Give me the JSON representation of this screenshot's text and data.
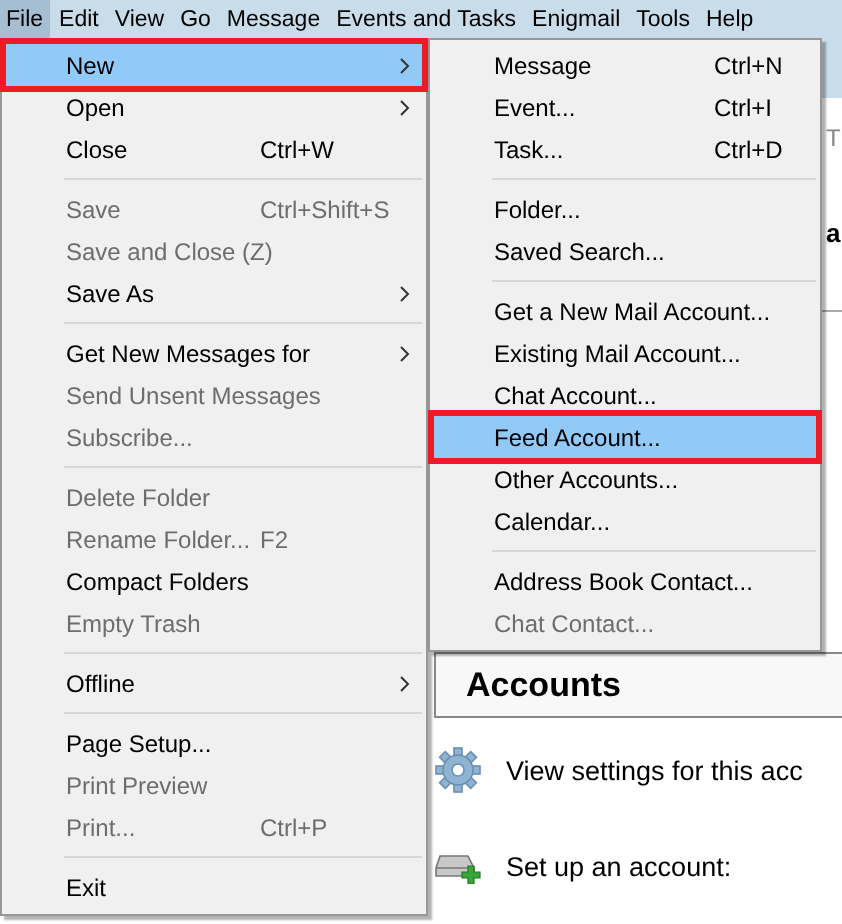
{
  "menu_bar": [
    {
      "label": "File",
      "selected": true
    },
    {
      "label": "Edit",
      "selected": false
    },
    {
      "label": "View",
      "selected": false
    },
    {
      "label": "Go",
      "selected": false
    },
    {
      "label": "Message",
      "selected": false
    },
    {
      "label": "Events and Tasks",
      "selected": false
    },
    {
      "label": "Enigmail",
      "selected": false
    },
    {
      "label": "Tools",
      "selected": false
    },
    {
      "label": "Help",
      "selected": false
    }
  ],
  "background": {
    "tab_label": "T",
    "heading": "a",
    "accounts": {
      "title": "Accounts",
      "rows": [
        {
          "kind": "settings",
          "label": "View settings for this acc"
        },
        {
          "kind": "setup",
          "label": "Set up an account:"
        }
      ]
    }
  },
  "file_menu": [
    {
      "kind": "item",
      "label": "New",
      "submenu": true,
      "disabled": false,
      "selected": true,
      "outlined": true
    },
    {
      "kind": "item",
      "label": "Open",
      "submenu": true,
      "disabled": false,
      "selected": false,
      "outlined": false
    },
    {
      "kind": "item",
      "label": "Close",
      "shortcut": "Ctrl+W",
      "disabled": false,
      "selected": false,
      "outlined": false
    },
    {
      "kind": "separator"
    },
    {
      "kind": "item",
      "label": "Save",
      "shortcut": "Ctrl+Shift+S",
      "disabled": true,
      "selected": false,
      "outlined": false
    },
    {
      "kind": "item",
      "label": "Save and Close (Z)",
      "disabled": true,
      "selected": false,
      "outlined": false
    },
    {
      "kind": "item",
      "label": "Save As",
      "submenu": true,
      "disabled": false,
      "selected": false,
      "outlined": false
    },
    {
      "kind": "separator"
    },
    {
      "kind": "item",
      "label": "Get New Messages for",
      "submenu": true,
      "disabled": false,
      "selected": false,
      "outlined": false
    },
    {
      "kind": "item",
      "label": "Send Unsent Messages",
      "disabled": true,
      "selected": false,
      "outlined": false
    },
    {
      "kind": "item",
      "label": "Subscribe...",
      "disabled": true,
      "selected": false,
      "outlined": false
    },
    {
      "kind": "separator"
    },
    {
      "kind": "item",
      "label": "Delete Folder",
      "disabled": true,
      "selected": false,
      "outlined": false
    },
    {
      "kind": "item",
      "label": "Rename Folder...",
      "shortcut": "F2",
      "disabled": true,
      "selected": false,
      "outlined": false
    },
    {
      "kind": "item",
      "label": "Compact Folders",
      "disabled": false,
      "selected": false,
      "outlined": false
    },
    {
      "kind": "item",
      "label": "Empty Trash",
      "disabled": true,
      "selected": false,
      "outlined": false
    },
    {
      "kind": "separator"
    },
    {
      "kind": "item",
      "label": "Offline",
      "submenu": true,
      "disabled": false,
      "selected": false,
      "outlined": false
    },
    {
      "kind": "separator"
    },
    {
      "kind": "item",
      "label": "Page Setup...",
      "disabled": false,
      "selected": false,
      "outlined": false
    },
    {
      "kind": "item",
      "label": "Print Preview",
      "disabled": true,
      "selected": false,
      "outlined": false
    },
    {
      "kind": "item",
      "label": "Print...",
      "shortcut": "Ctrl+P",
      "disabled": true,
      "selected": false,
      "outlined": false
    },
    {
      "kind": "separator"
    },
    {
      "kind": "item",
      "label": "Exit",
      "disabled": false,
      "selected": false,
      "outlined": false
    }
  ],
  "new_submenu": [
    {
      "kind": "item",
      "label": "Message",
      "shortcut": "Ctrl+N",
      "disabled": false,
      "selected": false,
      "outlined": false
    },
    {
      "kind": "item",
      "label": "Event...",
      "shortcut": "Ctrl+I",
      "disabled": false,
      "selected": false,
      "outlined": false
    },
    {
      "kind": "item",
      "label": "Task...",
      "shortcut": "Ctrl+D",
      "disabled": false,
      "selected": false,
      "outlined": false
    },
    {
      "kind": "separator"
    },
    {
      "kind": "item",
      "label": "Folder...",
      "disabled": false,
      "selected": false,
      "outlined": false
    },
    {
      "kind": "item",
      "label": "Saved Search...",
      "disabled": false,
      "selected": false,
      "outlined": false
    },
    {
      "kind": "separator"
    },
    {
      "kind": "item",
      "label": "Get a New Mail Account...",
      "disabled": false,
      "selected": false,
      "outlined": false
    },
    {
      "kind": "item",
      "label": "Existing Mail Account...",
      "disabled": false,
      "selected": false,
      "outlined": false
    },
    {
      "kind": "item",
      "label": "Chat Account...",
      "disabled": false,
      "selected": false,
      "outlined": false
    },
    {
      "kind": "item",
      "label": "Feed Account...",
      "disabled": false,
      "selected": true,
      "outlined": true
    },
    {
      "kind": "item",
      "label": "Other Accounts...",
      "disabled": false,
      "selected": false,
      "outlined": false
    },
    {
      "kind": "item",
      "label": "Calendar...",
      "disabled": false,
      "selected": false,
      "outlined": false
    },
    {
      "kind": "separator"
    },
    {
      "kind": "item",
      "label": "Address Book Contact...",
      "disabled": false,
      "selected": false,
      "outlined": false
    },
    {
      "kind": "item",
      "label": "Chat Contact...",
      "disabled": true,
      "selected": false,
      "outlined": false
    }
  ]
}
